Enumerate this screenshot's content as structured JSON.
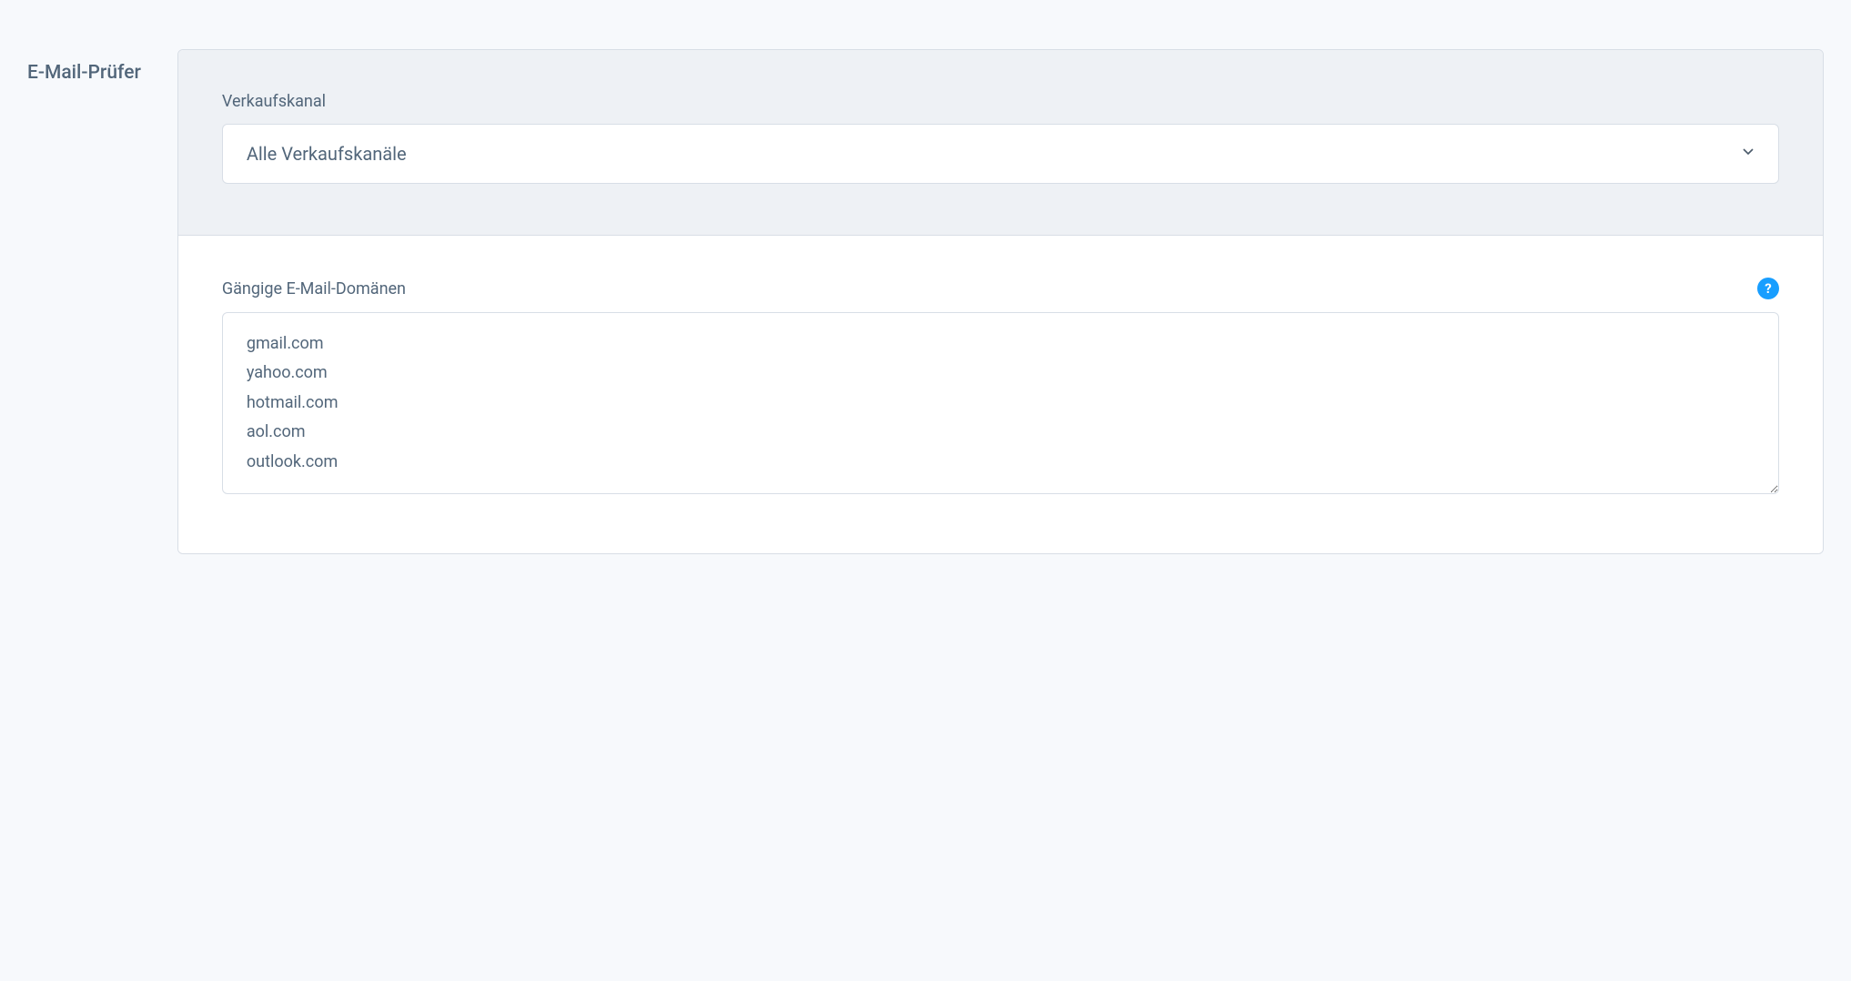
{
  "sidebar": {
    "title": "E-Mail-Prüfer"
  },
  "salesChannel": {
    "label": "Verkaufskanal",
    "selected": "Alle Verkaufskanäle"
  },
  "emailDomains": {
    "label": "Gängige E-Mail-Domänen",
    "value": "gmail.com\nyahoo.com\nhotmail.com\naol.com\noutlook.com"
  }
}
